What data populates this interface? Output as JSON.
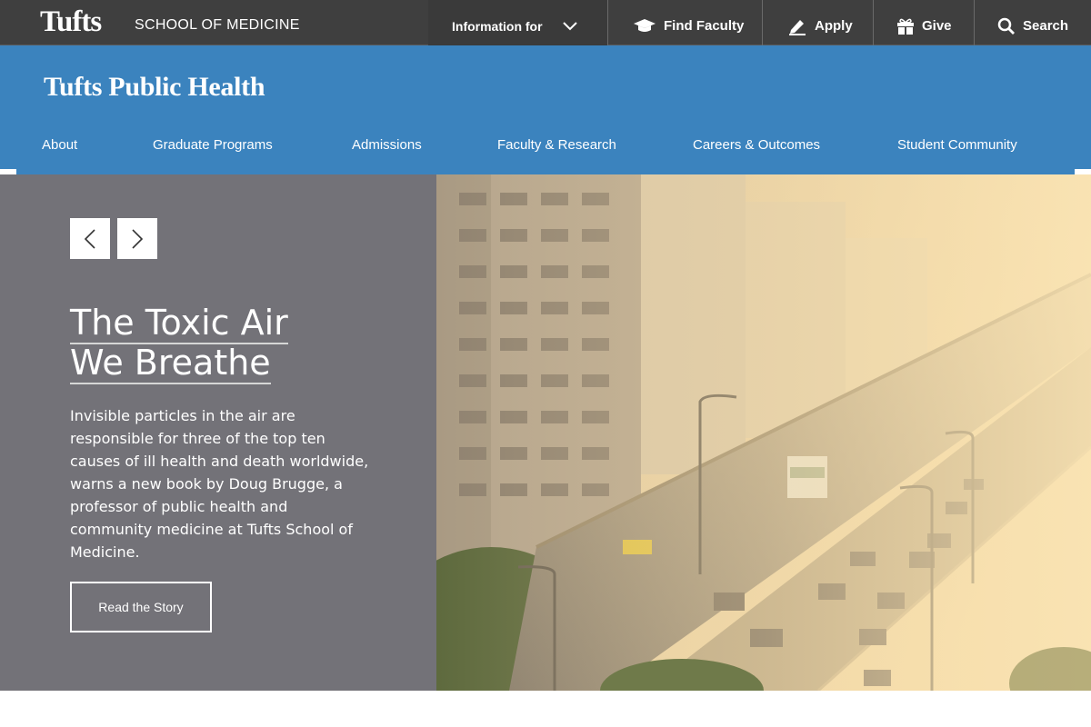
{
  "topbar": {
    "logo": "Tufts",
    "school": "SCHOOL OF MEDICINE",
    "info_for": "Information for",
    "find_faculty": "Find Faculty",
    "apply": "Apply",
    "give": "Give",
    "search": "Search"
  },
  "header": {
    "site_title": "Tufts Public Health"
  },
  "nav": {
    "items": [
      "About",
      "Graduate Programs",
      "Admissions",
      "Faculty & Research",
      "Careers & Outcomes",
      "Student Community"
    ]
  },
  "hero": {
    "headline_line1": "The Toxic Air",
    "headline_line2": "We Breathe",
    "summary": "Invisible particles in the air are responsible for three of the top ten causes of ill health and death worldwide, warns a new book by Doug Brugge, a professor of public health and community medicine at Tufts School of Medicine.",
    "cta": "Read the Story"
  },
  "colors": {
    "topbar": "#3f3f3f",
    "brand_blue": "#3b83be",
    "hero_panel": "#737278"
  },
  "icons": [
    "chevron-down-icon",
    "graduation-cap-icon",
    "pencil-icon",
    "gift-icon",
    "search-icon",
    "arrow-left-icon",
    "arrow-right-icon"
  ]
}
